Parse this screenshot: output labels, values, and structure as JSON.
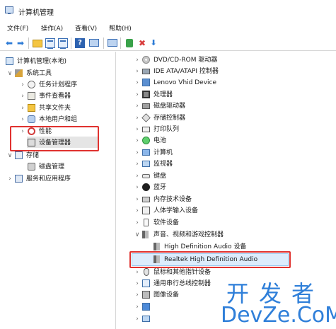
{
  "window": {
    "title": "计算机管理"
  },
  "menu": [
    "文件(F)",
    "操作(A)",
    "查看(V)",
    "帮助(H)"
  ],
  "toolbar": {
    "icons": [
      "back-arrow-icon",
      "forward-arrow-icon",
      "folder-up-icon",
      "show-hide-tree-icon",
      "properties-icon",
      "help-icon",
      "show-console-icon",
      "scan-hardware-icon",
      "update-driver-icon",
      "disable-device-icon",
      "uninstall-device-icon"
    ]
  },
  "left_tree": {
    "root": "计算机管理(本地)",
    "system_tools": "系统工具",
    "task_scheduler": "任务计划程序",
    "event_viewer": "事件查看器",
    "shared_folders": "共享文件夹",
    "local_users": "本地用户和组",
    "performance": "性能",
    "device_manager": "设备管理器",
    "storage": "存储",
    "disk_management": "磁盘管理",
    "services_apps": "服务和应用程序"
  },
  "devices": [
    "DVD/CD-ROM 驱动器",
    "IDE ATA/ATAPI 控制器",
    "Lenovo Vhid Device",
    "处理器",
    "磁盘驱动器",
    "存储控制器",
    "打印队列",
    "电池",
    "计算机",
    "监视器",
    "键盘",
    "蓝牙",
    "内存技术设备",
    "人体学输入设备",
    "软件设备",
    "声音、视频和游戏控制器",
    "High Definition Audio 设备",
    "Realtek High Definition Audio",
    "鼠标和其他指针设备",
    "通用串行总线控制器",
    "图像设备"
  ],
  "watermark": {
    "line1": "开发者",
    "line2": "DevZe.CoM"
  },
  "colors": {
    "highlight_box": "#e0322f",
    "selection": "#dcecfc",
    "watermark": "#2f7fd9"
  }
}
